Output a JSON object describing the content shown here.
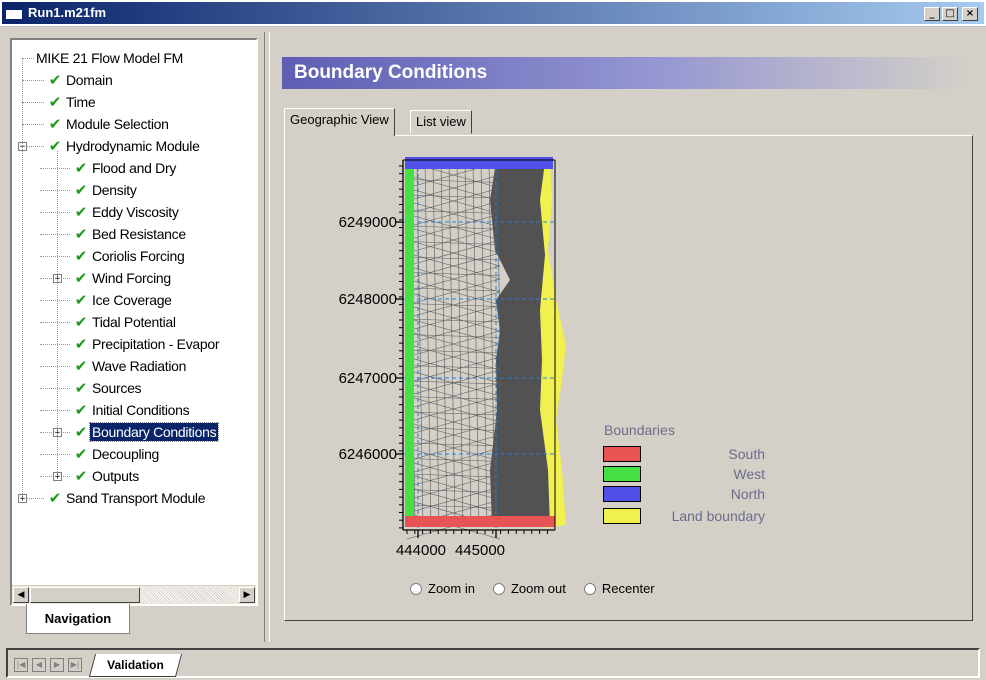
{
  "window": {
    "title": "Run1.m21fm"
  },
  "window_buttons": {
    "minimize": "_",
    "maximize": "□",
    "close": "×"
  },
  "tree": {
    "items": [
      {
        "label": "MIKE 21 Flow Model FM",
        "level": 0,
        "check": false,
        "expander": ""
      },
      {
        "label": "Domain",
        "level": 1,
        "check": true,
        "expander": ""
      },
      {
        "label": "Time",
        "level": 1,
        "check": true,
        "expander": ""
      },
      {
        "label": "Module Selection",
        "level": 1,
        "check": true,
        "expander": ""
      },
      {
        "label": "Hydrodynamic Module",
        "level": 1,
        "check": true,
        "expander": "−"
      },
      {
        "label": "Flood and Dry",
        "level": 2,
        "check": true,
        "expander": ""
      },
      {
        "label": "Density",
        "level": 2,
        "check": true,
        "expander": ""
      },
      {
        "label": "Eddy Viscosity",
        "level": 2,
        "check": true,
        "expander": ""
      },
      {
        "label": "Bed Resistance",
        "level": 2,
        "check": true,
        "expander": ""
      },
      {
        "label": "Coriolis Forcing",
        "level": 2,
        "check": true,
        "expander": ""
      },
      {
        "label": "Wind Forcing",
        "level": 2,
        "check": true,
        "expander": "+"
      },
      {
        "label": "Ice Coverage",
        "level": 2,
        "check": true,
        "expander": ""
      },
      {
        "label": "Tidal Potential",
        "level": 2,
        "check": true,
        "expander": ""
      },
      {
        "label": "Precipitation - Evapor",
        "level": 2,
        "check": true,
        "expander": ""
      },
      {
        "label": "Wave Radiation",
        "level": 2,
        "check": true,
        "expander": ""
      },
      {
        "label": "Sources",
        "level": 2,
        "check": true,
        "expander": ""
      },
      {
        "label": "Initial Conditions",
        "level": 2,
        "check": true,
        "expander": ""
      },
      {
        "label": "Boundary Conditions",
        "level": 2,
        "check": true,
        "expander": "+",
        "selected": true
      },
      {
        "label": "Decoupling",
        "level": 2,
        "check": true,
        "expander": ""
      },
      {
        "label": "Outputs",
        "level": 2,
        "check": true,
        "expander": "+"
      },
      {
        "label": "Sand Transport Module",
        "level": 1,
        "check": true,
        "expander": "+"
      }
    ]
  },
  "left_tab": {
    "label": "Navigation"
  },
  "main": {
    "title": "Boundary Conditions",
    "tabs": [
      {
        "label": "Geographic View",
        "active": true
      },
      {
        "label": "List view",
        "active": false
      }
    ]
  },
  "map": {
    "y_ticks": [
      "6249000",
      "6248000",
      "6247000",
      "6246000"
    ],
    "x_ticks": [
      "444000",
      "445000"
    ],
    "legend": {
      "title": "Boundaries",
      "items": [
        {
          "label": "South",
          "color": "#e85454"
        },
        {
          "label": "West",
          "color": "#44e044"
        },
        {
          "label": "North",
          "color": "#5050e8"
        },
        {
          "label": "Land boundary",
          "color": "#f0f050"
        }
      ]
    }
  },
  "zoom_controls": {
    "zoom_in": "Zoom in",
    "zoom_out": "Zoom out",
    "recenter": "Recenter"
  },
  "status_bar": {
    "tab": "Validation"
  }
}
